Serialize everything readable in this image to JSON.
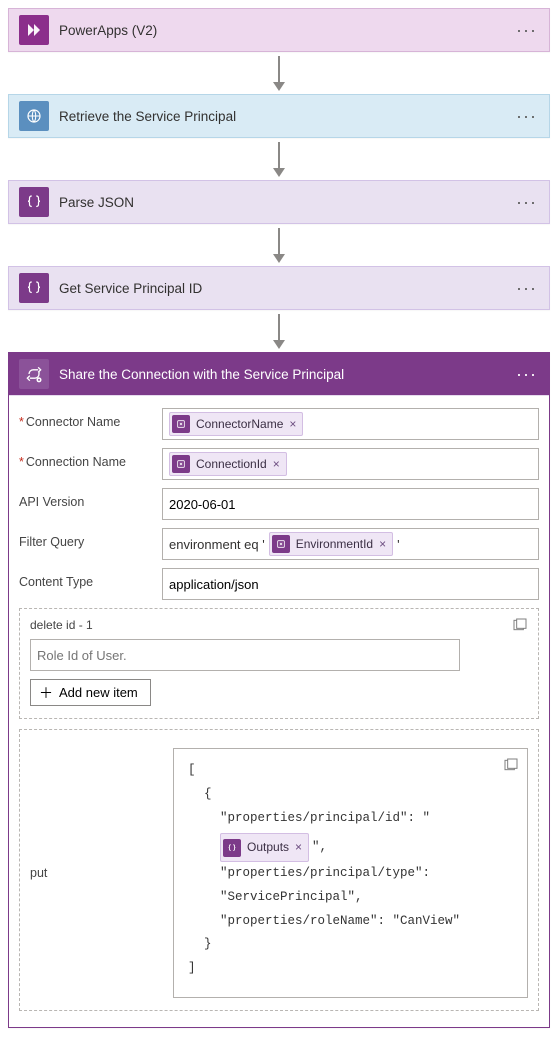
{
  "steps": {
    "s1": {
      "title": "PowerApps (V2)"
    },
    "s2": {
      "title": "Retrieve the Service Principal"
    },
    "s3": {
      "title": "Parse JSON"
    },
    "s4": {
      "title": "Get Service Principal ID"
    },
    "s5": {
      "title": "Share the Connection with the Service Principal"
    }
  },
  "form": {
    "connectorName": {
      "label": "Connector Name",
      "token": "ConnectorName"
    },
    "connectionName": {
      "label": "Connection Name",
      "token": "ConnectionId"
    },
    "apiVersion": {
      "label": "API Version",
      "value": "2020-06-01"
    },
    "filterQuery": {
      "label": "Filter Query",
      "prefix": "environment eq '",
      "token": "EnvironmentId",
      "suffix": "'"
    },
    "contentType": {
      "label": "Content Type",
      "value": "application/json"
    }
  },
  "deleteSection": {
    "heading": "delete id - 1",
    "placeholder": "Role Id of User.",
    "addItem": "Add new item"
  },
  "putSection": {
    "label": "put",
    "line0": "[",
    "line1": "{",
    "line2a": "\"properties/principal/id\": \"",
    "outputsToken": "Outputs",
    "line2b": "\",",
    "line3": "\"properties/principal/type\": \"ServicePrincipal\",",
    "line4": "\"properties/roleName\": \"CanView\"",
    "line5": "}",
    "line6": "]"
  },
  "icons": {
    "dots": "···",
    "plus": "＋",
    "close": "×"
  }
}
